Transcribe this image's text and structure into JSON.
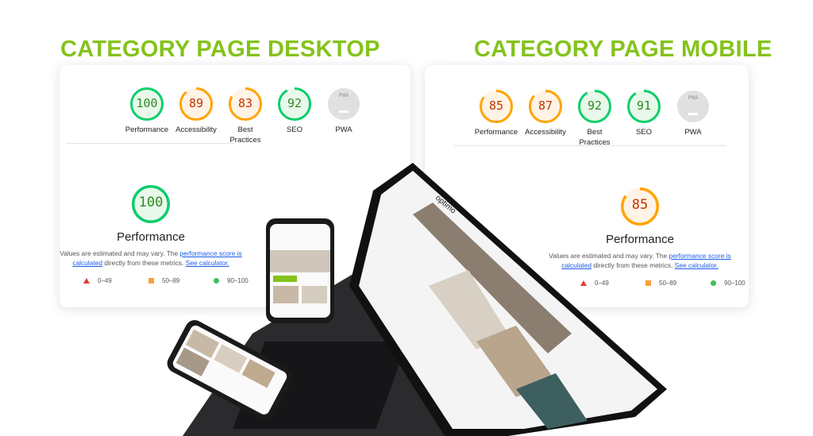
{
  "desktop": {
    "title": "CATEGORY PAGE DESKTOP",
    "scores": [
      {
        "label": "Performance",
        "value": "100",
        "level": "pass"
      },
      {
        "label": "Accessibility",
        "value": "89",
        "level": "average"
      },
      {
        "label": "Best Practices",
        "value": "83",
        "level": "average"
      },
      {
        "label": "SEO",
        "value": "92",
        "level": "pass"
      },
      {
        "label": "PWA",
        "value": "",
        "level": "na"
      }
    ],
    "main": {
      "value": "100",
      "level": "pass",
      "label": "Performance"
    },
    "desc": {
      "text1": "Values are estimated and may vary. The ",
      "link1": "performance score is calculated",
      "text2": " directly from these metrics. ",
      "link2": "See calculator."
    },
    "legend": [
      "0–49",
      "50–89",
      "90–100"
    ]
  },
  "mobile": {
    "title": "CATEGORY PAGE MOBILE",
    "scores": [
      {
        "label": "Performance",
        "value": "85",
        "level": "average"
      },
      {
        "label": "Accessibility",
        "value": "87",
        "level": "average"
      },
      {
        "label": "Best Practices",
        "value": "92",
        "level": "pass"
      },
      {
        "label": "SEO",
        "value": "91",
        "level": "pass"
      },
      {
        "label": "PWA",
        "value": "",
        "level": "na"
      }
    ],
    "main": {
      "value": "85",
      "level": "average",
      "label": "Performance"
    },
    "desc": {
      "text1": "Values are estimated and may vary. The ",
      "link1": "performance score is calculated",
      "text2": " directly from these metrics. ",
      "link2": "See calculator."
    },
    "legend": [
      "0–49",
      "50–89",
      "90–100"
    ]
  },
  "pwa_badge": "PWA",
  "brand": "optimo",
  "colors": {
    "accent": "#84c31a",
    "pass": "#0cce6b",
    "average": "#ffa400",
    "fail": "#ff4e42"
  }
}
